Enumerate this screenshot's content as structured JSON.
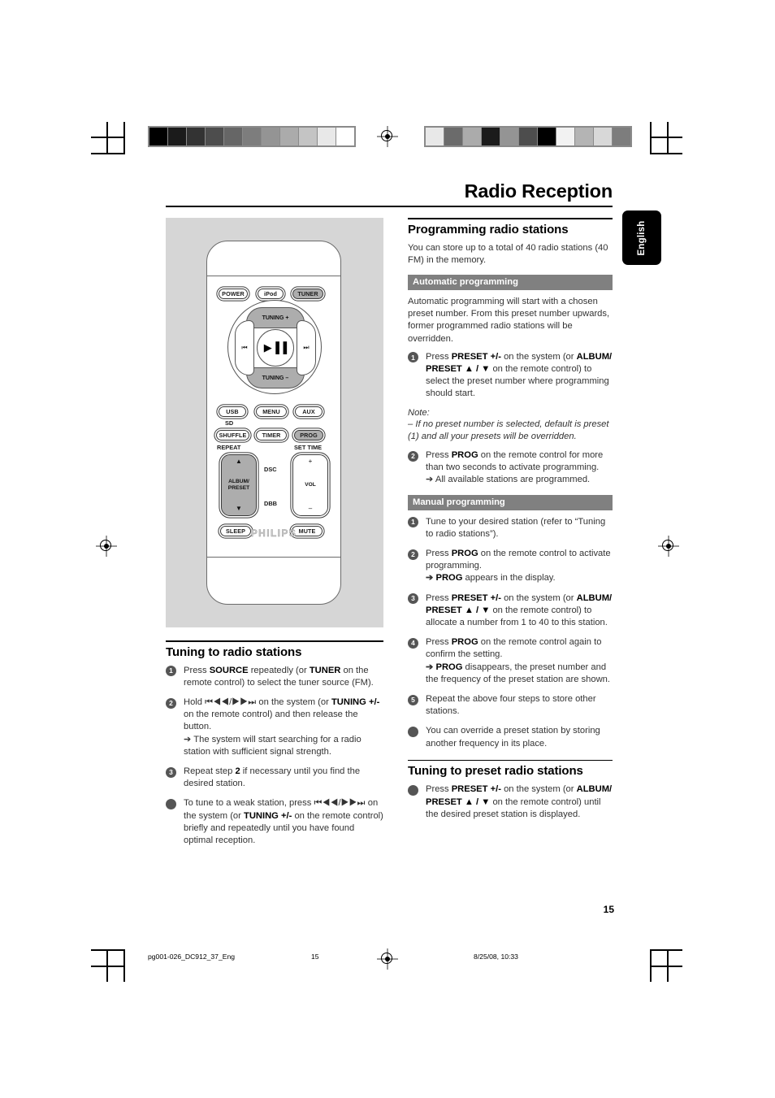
{
  "page": {
    "title": "Radio Reception",
    "language_tab": "English",
    "page_number": "15"
  },
  "footer": {
    "file": "pg001-026_DC912_37_Eng",
    "page": "15",
    "timestamp": "8/25/08, 10:33"
  },
  "figure": {
    "caption_alt": "remote-control-diagram",
    "brand": "PHILIPS",
    "top_buttons": [
      {
        "name": "power-button",
        "label": "POWER",
        "shade": "white"
      },
      {
        "name": "ipod-button",
        "label": "iPod",
        "shade": "white"
      },
      {
        "name": "tuner-button",
        "label": "TUNER",
        "shade": "grey"
      }
    ],
    "wheel": {
      "top_label": "TUNING +",
      "bottom_label": "TUNING –",
      "left_label": "⏮",
      "right_label": "⏭",
      "center_label": "▶▐▐"
    },
    "mid_buttons": [
      {
        "name": "usb-button",
        "label": "USB",
        "shade": "white"
      },
      {
        "name": "menu-button",
        "label": "MENU",
        "shade": "white"
      },
      {
        "name": "aux-button",
        "label": "AUX",
        "shade": "white"
      },
      {
        "name": "shuffle-button",
        "label": "SHUFFLE",
        "shade": "white"
      },
      {
        "name": "timer-button",
        "label": "TIMER",
        "shade": "white"
      },
      {
        "name": "prog-button",
        "label": "PROG",
        "shade": "grey"
      }
    ],
    "small_labels": {
      "sd": "SD",
      "repeat": "REPEAT",
      "set_time": "SET TIME",
      "dsc": "DSC",
      "dbb": "DBB"
    },
    "rockers": {
      "album_preset": {
        "line1": "ALBUM/",
        "line2": "PRESET",
        "up": "▲",
        "down": "▼"
      },
      "volume": {
        "label": "VOL",
        "up": "+",
        "down": "–"
      }
    },
    "bottom_buttons": [
      {
        "name": "sleep-button",
        "label": "SLEEP",
        "shade": "white"
      },
      {
        "name": "mute-button",
        "label": "MUTE",
        "shade": "white"
      }
    ]
  },
  "left_column": {
    "heading": "Tuning to radio stations",
    "steps": [
      {
        "marker": "1",
        "type": "number",
        "parts": [
          {
            "t": "Press ",
            "b": false
          },
          {
            "t": "SOURCE",
            "b": true
          },
          {
            "t": " repeatedly (or ",
            "b": false
          },
          {
            "t": "TUNER",
            "b": true
          },
          {
            "t": " on the remote control) to select the tuner source (FM).",
            "b": false
          }
        ]
      },
      {
        "marker": "2",
        "type": "number",
        "parts": [
          {
            "t": "Hold ",
            "b": false
          },
          {
            "t": "⏮◀◀/▶▶⏭",
            "b": false
          },
          {
            "t": " on the system (or ",
            "b": false
          },
          {
            "t": "TUNING +/-",
            "b": true
          },
          {
            "t": " on the remote control) and then release the button.",
            "b": false
          }
        ],
        "arrow": "➔ The system will start searching for a radio station with sufficient signal strength."
      },
      {
        "marker": "3",
        "type": "number",
        "parts": [
          {
            "t": "Repeat step ",
            "b": false
          },
          {
            "t": "2",
            "b": true
          },
          {
            "t": " if necessary until you find the desired station.",
            "b": false
          }
        ]
      },
      {
        "marker": "•",
        "type": "bullet",
        "parts": [
          {
            "t": "To tune to a weak station, press ",
            "b": false
          },
          {
            "t": "⏮◀◀/▶▶⏭",
            "b": false
          },
          {
            "t": " on the system (or ",
            "b": false
          },
          {
            "t": "TUNING +/-",
            "b": true
          },
          {
            "t": " on the remote control) briefly and repeatedly until you have found optimal reception.",
            "b": false
          }
        ]
      }
    ]
  },
  "right_column": {
    "heading": "Programming radio stations",
    "intro": "You can store up to a total of 40 radio stations (40 FM) in the memory.",
    "auto": {
      "bar": "Automatic programming",
      "intro": "Automatic programming will start with a chosen preset number. From this preset number upwards, former programmed radio stations will be overridden.",
      "note_title": "Note:",
      "note": "–  If no preset number is selected, default is preset (1) and all your presets will be overridden.",
      "steps": [
        {
          "marker": "1",
          "type": "number",
          "parts": [
            {
              "t": "Press ",
              "b": false
            },
            {
              "t": "PRESET +/-",
              "b": true
            },
            {
              "t": " on the system (or ",
              "b": false
            },
            {
              "t": "ALBUM/ PRESET ▲ / ▼",
              "b": true
            },
            {
              "t": " on the remote control) to select the preset number where programming should start.",
              "b": false
            }
          ]
        },
        {
          "marker": "2",
          "type": "number",
          "parts": [
            {
              "t": "Press ",
              "b": false
            },
            {
              "t": "PROG",
              "b": true
            },
            {
              "t": " on the remote control for more than two seconds to activate programming.",
              "b": false
            }
          ],
          "arrow": "➔ All available stations are programmed."
        }
      ]
    },
    "manual": {
      "bar": "Manual programming",
      "steps": [
        {
          "marker": "1",
          "type": "number",
          "parts": [
            {
              "t": "Tune to your desired station (refer to “Tuning to radio stations”).",
              "b": false
            }
          ]
        },
        {
          "marker": "2",
          "type": "number",
          "parts": [
            {
              "t": "Press ",
              "b": false
            },
            {
              "t": "PROG",
              "b": true
            },
            {
              "t": " on the remote control to activate programming.",
              "b": false
            }
          ],
          "arrow_bold": "PROG",
          "arrow_rest": " appears in the display."
        },
        {
          "marker": "3",
          "type": "number",
          "parts": [
            {
              "t": "Press ",
              "b": false
            },
            {
              "t": "PRESET +/-",
              "b": true
            },
            {
              "t": " on the system (or ",
              "b": false
            },
            {
              "t": "ALBUM/ PRESET ▲ / ▼",
              "b": true
            },
            {
              "t": " on the remote control) to allocate a number from 1 to 40 to this station.",
              "b": false
            }
          ]
        },
        {
          "marker": "4",
          "type": "number",
          "parts": [
            {
              "t": "Press ",
              "b": false
            },
            {
              "t": "PROG",
              "b": true
            },
            {
              "t": " on the remote control again to confirm the setting.",
              "b": false
            }
          ],
          "arrow_bold": "PROG",
          "arrow_rest": " disappears, the preset number and the frequency of the preset station are shown."
        },
        {
          "marker": "5",
          "type": "number",
          "parts": [
            {
              "t": "Repeat the above four steps to store other stations.",
              "b": false
            }
          ]
        },
        {
          "marker": "•",
          "type": "bullet",
          "parts": [
            {
              "t": "You can override a preset station by storing another frequency in its place.",
              "b": false
            }
          ]
        }
      ]
    },
    "preset_tuning": {
      "heading": "Tuning to preset radio stations",
      "steps": [
        {
          "marker": "•",
          "type": "bullet",
          "parts": [
            {
              "t": "Press ",
              "b": false
            },
            {
              "t": "PRESET +/-",
              "b": true
            },
            {
              "t": " on the system (or ",
              "b": false
            },
            {
              "t": "ALBUM/ PRESET ▲ / ▼",
              "b": true
            },
            {
              "t": " on the remote control) until the desired preset station is displayed.",
              "b": false
            }
          ]
        }
      ]
    }
  },
  "calibration": {
    "left_wedge": [
      "#000000",
      "#1b1b1b",
      "#333333",
      "#4d4d4d",
      "#666666",
      "#7d7d7d",
      "#949494",
      "#ababab",
      "#c4c4c4",
      "#e8e8e8",
      "#ffffff"
    ],
    "right_wedge": [
      "#e8e8e8",
      "#6b6b6b",
      "#ababab",
      "#1b1b1b",
      "#949494",
      "#4d4d4d",
      "#000000",
      "#f2f2f2",
      "#b4b4b4",
      "#d8d8d8",
      "#7d7d7d"
    ]
  }
}
